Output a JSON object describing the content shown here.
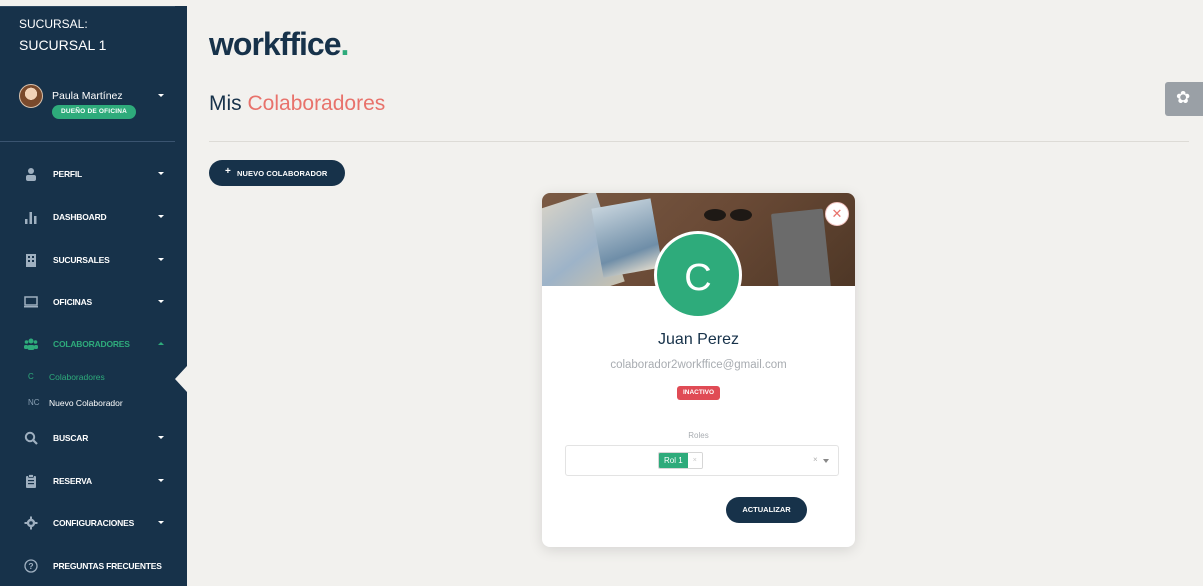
{
  "sidebar": {
    "branch_label": "SUCURSAL:",
    "branch_name": "SUCURSAL 1",
    "user": {
      "name": "Paula Martínez",
      "role": "DUEÑO DE OFICINA"
    },
    "items": [
      {
        "label": "PERFIL",
        "icon": "user-icon"
      },
      {
        "label": "DASHBOARD",
        "icon": "bar-chart-icon"
      },
      {
        "label": "SUCURSALES",
        "icon": "building-icon"
      },
      {
        "label": "OFICINAS",
        "icon": "monitor-icon"
      },
      {
        "label": "COLABORADORES",
        "icon": "users-icon"
      },
      {
        "label": "BUSCAR",
        "icon": "search-icon"
      },
      {
        "label": "RESERVA",
        "icon": "clipboard-icon"
      },
      {
        "label": "CONFIGURACIONES",
        "icon": "gear-icon"
      },
      {
        "label": "PREGUNTAS FRECUENTES",
        "icon": "help-icon"
      }
    ],
    "subitems": [
      {
        "abbr": "C",
        "label": "Colaboradores"
      },
      {
        "abbr": "NC",
        "label": "Nuevo Colaborador"
      }
    ]
  },
  "header": {
    "logo": "workffice",
    "logo_dot": ".",
    "title": "Mis",
    "title_accent": "Colaboradores"
  },
  "toolbar": {
    "new_button": "NUEVO COLABORADOR"
  },
  "card": {
    "avatar_letter": "C",
    "name": "Juan Perez",
    "email": "colaborador2workffice@gmail.com",
    "status": "INACTIVO",
    "roles_label": "Roles",
    "selected_role": "Rol 1",
    "tag_remove": "×",
    "clear": "×",
    "update_button": "ACTUALIZAR"
  },
  "colors": {
    "navy": "#17324a",
    "green": "#2eab7b",
    "coral": "#e8726b",
    "inactive_red": "#e04b55",
    "background": "#f2f1ee"
  }
}
